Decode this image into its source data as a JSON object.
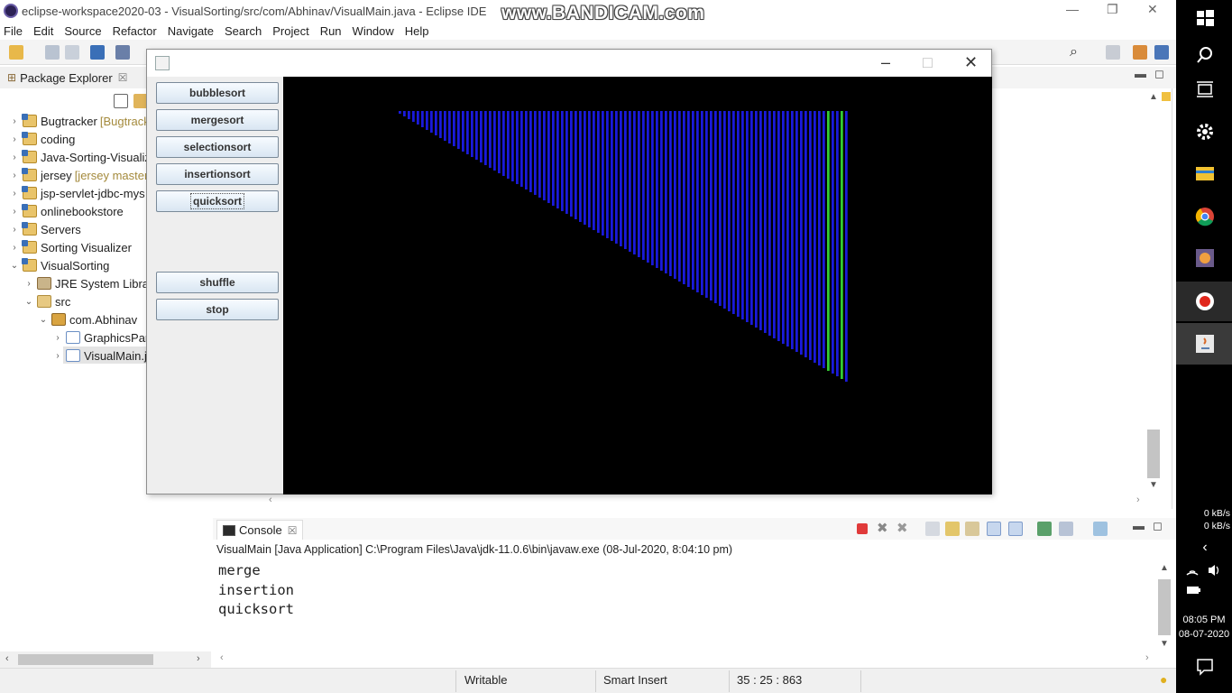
{
  "window": {
    "title": "eclipse-workspace2020-03 - VisualSorting/src/com/Abhinav/VisualMain.java - Eclipse IDE",
    "watermark": "www.BANDICAM.com"
  },
  "menu": [
    "File",
    "Edit",
    "Source",
    "Refactor",
    "Navigate",
    "Search",
    "Project",
    "Run",
    "Window",
    "Help"
  ],
  "package_explorer": {
    "title": "Package Explorer",
    "close": "☒",
    "items": [
      {
        "label": "Bugtracker",
        "suffix": "[Bugtrack",
        "expanded": false,
        "depth": 0,
        "icon": "project-icon"
      },
      {
        "label": "coding",
        "suffix": "",
        "expanded": false,
        "depth": 0,
        "icon": "project-icon"
      },
      {
        "label": "Java-Sorting-Visualiz",
        "suffix": "",
        "expanded": false,
        "depth": 0,
        "icon": "project-icon"
      },
      {
        "label": "jersey",
        "suffix": "[jersey master",
        "expanded": false,
        "depth": 0,
        "icon": "project-icon"
      },
      {
        "label": "jsp-servlet-jdbc-mys",
        "suffix": "",
        "expanded": false,
        "depth": 0,
        "icon": "project-icon"
      },
      {
        "label": "onlinebookstore",
        "suffix": "",
        "expanded": false,
        "depth": 0,
        "icon": "project-icon"
      },
      {
        "label": "Servers",
        "suffix": "",
        "expanded": false,
        "depth": 0,
        "icon": "folder-icon"
      },
      {
        "label": "Sorting Visualizer",
        "suffix": "",
        "expanded": false,
        "depth": 0,
        "icon": "folder-icon"
      },
      {
        "label": "VisualSorting",
        "suffix": "",
        "expanded": true,
        "depth": 0,
        "icon": "project-icon"
      },
      {
        "label": "JRE System Librar",
        "suffix": "",
        "expanded": false,
        "depth": 1,
        "icon": "library-icon"
      },
      {
        "label": "src",
        "suffix": "",
        "expanded": true,
        "depth": 1,
        "icon": "source-folder-icon"
      },
      {
        "label": "com.Abhinav",
        "suffix": "",
        "expanded": true,
        "depth": 2,
        "icon": "package-icon"
      },
      {
        "label": "GraphicsPan",
        "suffix": "",
        "expanded": false,
        "depth": 3,
        "icon": "java-file-icon"
      },
      {
        "label": "VisualMain.j",
        "suffix": "",
        "expanded": false,
        "depth": 3,
        "icon": "java-file-icon"
      }
    ]
  },
  "console": {
    "tab_label": "Console",
    "close": "☒",
    "description": "VisualMain [Java Application] C:\\Program Files\\Java\\jdk-11.0.6\\bin\\javaw.exe  (08-Jul-2020, 8:04:10 pm)",
    "lines": [
      "merge",
      "insertion",
      "quicksort"
    ]
  },
  "statusbar": {
    "writable": "Writable",
    "insert_mode": "Smart Insert",
    "position": "35 : 25 : 863"
  },
  "sort_window": {
    "buttons": {
      "bubblesort": "bubblesort",
      "mergesort": "mergesort",
      "selectionsort": "selectionsort",
      "insertionsort": "insertionsort",
      "quicksort": "quicksort",
      "shuffle": "shuffle",
      "stop": "stop"
    },
    "focused_button": "quicksort",
    "bar_count": 100,
    "bar_color": "#1a1adc",
    "highlight_color": "#33cc33",
    "highlight_indices": [
      95,
      98
    ],
    "background": "#000000"
  },
  "taskbar": {
    "net_up": "0 kB/s",
    "net_down": "0 kB/s",
    "time": "08:05 PM",
    "date": "08-07-2020"
  }
}
